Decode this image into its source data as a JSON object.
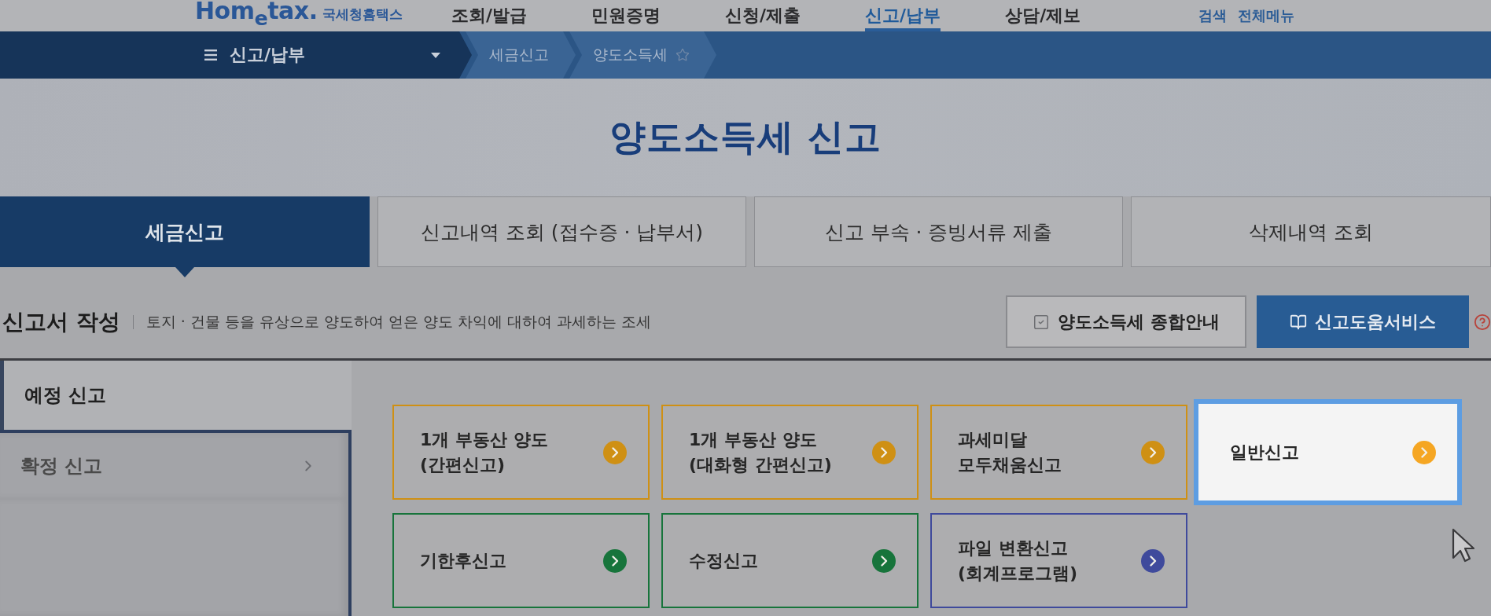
{
  "header": {
    "logo": {
      "wordmark": "Hom$_{e}$tax.",
      "subtitle": "국세청홈택스"
    },
    "nav": [
      {
        "label": "조회/발급",
        "selected": false
      },
      {
        "label": "민원증명",
        "selected": false
      },
      {
        "label": "신청/제출",
        "selected": false
      },
      {
        "label": "신고/납부",
        "selected": true
      },
      {
        "label": "상담/제보",
        "selected": false
      }
    ],
    "links": [
      "검색",
      "전체메뉴"
    ]
  },
  "breadcrumb": {
    "menu": "신고/납부",
    "crumbs": [
      "세금신고",
      "양도소득세"
    ]
  },
  "page_title": "양도소득세 신고",
  "tabs": [
    {
      "label": "세금신고",
      "selected": true
    },
    {
      "label": "신고내역 조회 (접수증 · 납부서)",
      "selected": false
    },
    {
      "label": "신고 부속 · 증빙서류 제출",
      "selected": false
    },
    {
      "label": "삭제내역 조회",
      "selected": false
    }
  ],
  "section": {
    "title": "신고서 작성",
    "description": "토지 · 건물 등을 유상으로 양도하여 얻은 양도 차익에 대하여 과세하는 조세",
    "buttons": [
      {
        "kind": "guide",
        "label": "양도소득세 종합안내"
      },
      {
        "kind": "help",
        "label": "신고도움서비스"
      }
    ]
  },
  "sidebar": {
    "items": [
      {
        "label": "예정 신고",
        "selected": true
      },
      {
        "label": "확정 신고",
        "selected": false
      }
    ]
  },
  "cards": [
    {
      "label": "1개 부동산 양도\n(간편신고)",
      "color": "#cf9014",
      "highlighted": false
    },
    {
      "label": "1개 부동산 양도\n(대화형 간편신고)",
      "color": "#cf9014",
      "highlighted": false
    },
    {
      "label": "과세미달\n모두채움신고",
      "color": "#cf9014",
      "highlighted": false
    },
    {
      "label": "일반신고",
      "color": "#f5a623",
      "highlighted": true
    },
    {
      "label": "기한후신고",
      "color": "#17743b",
      "highlighted": false
    },
    {
      "label": "수정신고",
      "color": "#17743b",
      "highlighted": false
    },
    {
      "label": "파일 변환신고\n(회계프로그램)",
      "color": "#3f4a9c",
      "highlighted": false
    }
  ]
}
